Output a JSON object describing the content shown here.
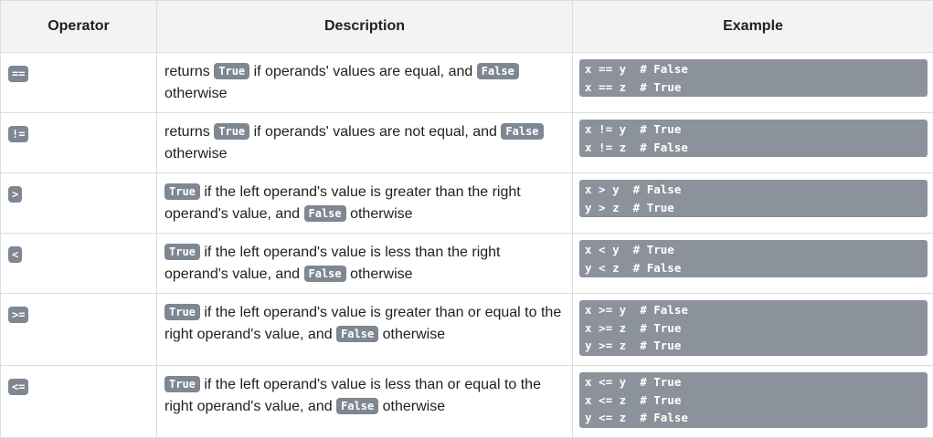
{
  "table": {
    "headers": {
      "operator": "Operator",
      "description": "Description",
      "example": "Example"
    },
    "rows": [
      {
        "operator": "==",
        "description": [
          "returns ",
          {
            "kw": "True"
          },
          " if operands' values are equal, and ",
          {
            "kw": "False"
          },
          " otherwise"
        ],
        "example": [
          "x == y  # False",
          "x == z  # True"
        ]
      },
      {
        "operator": "!=",
        "description": [
          "returns ",
          {
            "kw": "True"
          },
          " if operands' values are not equal, and ",
          {
            "kw": "False"
          },
          " otherwise"
        ],
        "example": [
          "x != y  # True",
          "x != z  # False"
        ]
      },
      {
        "operator": ">",
        "description": [
          {
            "kw": "True"
          },
          " if the left operand's value is greater than the right operand's value, and ",
          {
            "kw": "False"
          },
          " otherwise"
        ],
        "example": [
          "x > y  # False",
          "y > z  # True"
        ]
      },
      {
        "operator": "<",
        "description": [
          {
            "kw": "True"
          },
          " if the left operand's value is less than the right operand's value, and ",
          {
            "kw": "False"
          },
          " otherwise"
        ],
        "example": [
          "x < y  # True",
          "y < z  # False"
        ]
      },
      {
        "operator": ">=",
        "description": [
          {
            "kw": "True"
          },
          " if the left operand's value is greater than or equal to the right operand's value, and ",
          {
            "kw": "False"
          },
          " otherwise"
        ],
        "example": [
          "x >= y  # False",
          "x >= z  # True",
          "y >= z  # True"
        ]
      },
      {
        "operator": "<=",
        "description": [
          {
            "kw": "True"
          },
          " if the left operand's value is less than or equal to the right operand's value, and ",
          {
            "kw": "False"
          },
          " otherwise"
        ],
        "example": [
          "x <= y  # True",
          "x <= z  # True",
          "y <= z  # False"
        ]
      }
    ]
  }
}
